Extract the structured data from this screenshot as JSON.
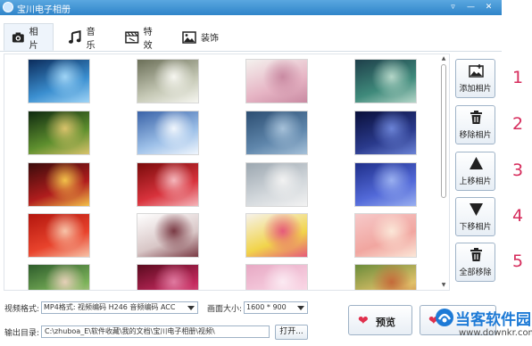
{
  "window": {
    "title": "宝川电子相册"
  },
  "tabs": [
    {
      "label": "相片",
      "icon": "camera-icon",
      "active": true
    },
    {
      "label": "音乐",
      "icon": "music-note-icon",
      "active": false
    },
    {
      "label": "特效",
      "icon": "clapperboard-icon",
      "active": false
    },
    {
      "label": "装饰",
      "icon": "picture-icon",
      "active": false
    }
  ],
  "photos": [
    {
      "icon": "photo-night-sky",
      "colors": [
        "#0b2c5c",
        "#3b8fd0",
        "#9fd4f6"
      ]
    },
    {
      "icon": "photo-white-horses",
      "colors": [
        "#6b6f58",
        "#c5c8b5",
        "#f6f6f0"
      ]
    },
    {
      "icon": "photo-floral-wreath",
      "colors": [
        "#f4f1ee",
        "#e6b4c4",
        "#c98aa2"
      ]
    },
    {
      "icon": "photo-fantasy-girl",
      "colors": [
        "#1e3f4a",
        "#3f8a7b",
        "#b4d6c8"
      ]
    },
    {
      "icon": "photo-green-fairy",
      "colors": [
        "#0f2a10",
        "#5e8f2e",
        "#d9c36b"
      ]
    },
    {
      "icon": "photo-snowy-forest",
      "colors": [
        "#3a63a8",
        "#9dc0e8",
        "#f0f6fd"
      ]
    },
    {
      "icon": "photo-blue-horizon",
      "colors": [
        "#2c4e72",
        "#5f86ab",
        "#a6c1d9"
      ]
    },
    {
      "icon": "photo-night-mountain",
      "colors": [
        "#090f3a",
        "#2a3a8c",
        "#6b83d6"
      ]
    },
    {
      "icon": "photo-snowman-lights",
      "colors": [
        "#3a0b0b",
        "#b01d1d",
        "#f3c14a"
      ]
    },
    {
      "icon": "photo-love-teacup",
      "colors": [
        "#7a0b0b",
        "#d8323c",
        "#f5b6bb"
      ]
    },
    {
      "icon": "photo-girl-portrait",
      "colors": [
        "#9ca7b0",
        "#d3d8dc",
        "#f2f2f2"
      ]
    },
    {
      "icon": "photo-blue-hydrangea",
      "colors": [
        "#1f2f8a",
        "#5269d8",
        "#9ab0f0"
      ]
    },
    {
      "icon": "photo-clock-2015",
      "colors": [
        "#b3160e",
        "#e8432c",
        "#f7c3a8"
      ]
    },
    {
      "icon": "photo-anime-girl",
      "colors": [
        "#ffffff",
        "#d8c6c6",
        "#7a3a44"
      ]
    },
    {
      "icon": "photo-balloons",
      "colors": [
        "#f6f2ea",
        "#f1d44b",
        "#e65a7a"
      ]
    },
    {
      "icon": "photo-cherry-blossom",
      "colors": [
        "#f6c9c9",
        "#f1a6a0",
        "#fbe7d8"
      ]
    },
    {
      "icon": "photo-woman-cheering",
      "colors": [
        "#2d5c2b",
        "#7cb35a",
        "#e6d0b8"
      ]
    },
    {
      "icon": "photo-red-flowers",
      "colors": [
        "#5a0a1e",
        "#c42a5e",
        "#e07aa0"
      ]
    },
    {
      "icon": "photo-pink-girl",
      "colors": [
        "#e7a9c4",
        "#f7cfe0",
        "#fbeaf2"
      ]
    },
    {
      "icon": "photo-garden-figures",
      "colors": [
        "#6b8c3a",
        "#e0c16a",
        "#c46a3a"
      ]
    }
  ],
  "actions": [
    {
      "label": "添加相片",
      "icon": "add-photo-icon",
      "number": "1"
    },
    {
      "label": "移除相片",
      "icon": "trash-icon",
      "number": "2"
    },
    {
      "label": "上移相片",
      "icon": "arrow-up-icon",
      "number": "3"
    },
    {
      "label": "下移相片",
      "icon": "arrow-down-icon",
      "number": "4"
    },
    {
      "label": "全部移除",
      "icon": "trash-icon",
      "number": "5"
    }
  ],
  "bottom": {
    "format_label": "视频格式:",
    "format_value": "MP4格式: 视频编码 H246 音频编码 ACC",
    "size_label": "画面大小:",
    "size_value": "1600 * 900",
    "output_label": "输出目录:",
    "output_value": "C:\\zhuboa_E\\软件收藏\\我的文档\\宝川电子相册\\视频\\",
    "open_label": "打开...",
    "preview_label": "预览"
  },
  "watermark": {
    "text": "当客软件园",
    "url": "www.downkr.com"
  },
  "colors": {
    "accent": "#2f84c9",
    "number": "#d62c5c"
  }
}
